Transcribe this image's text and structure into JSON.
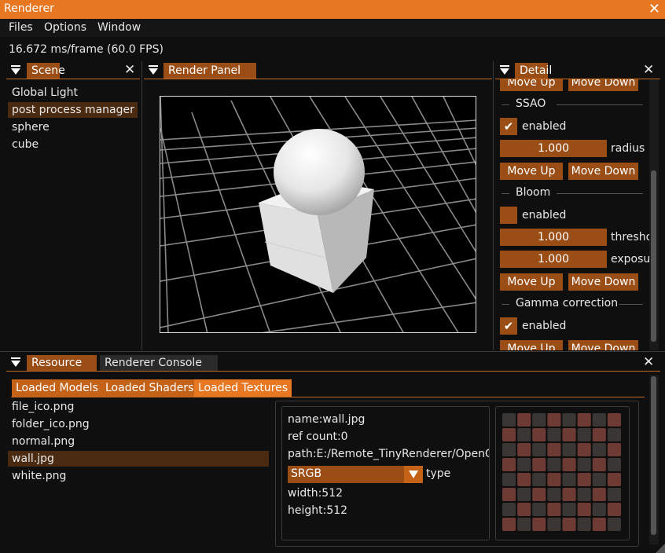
{
  "window": {
    "title": "Renderer"
  },
  "menu": [
    "Files",
    "Options",
    "Window"
  ],
  "status": {
    "fps_text": "16.672 ms/frame (60.0 FPS)"
  },
  "scene": {
    "tab": "Scene",
    "items": [
      "Global Light",
      "post process manager",
      "sphere",
      "cube"
    ],
    "selected_index": 1
  },
  "render_panel": {
    "tab": "Render Panel"
  },
  "detail": {
    "tab": "Detail",
    "move_up": "Move Up",
    "move_down": "Move Down",
    "enabled_label": "enabled",
    "sections": [
      {
        "title": "SSAO",
        "enabled": true,
        "fields": [
          {
            "value": "1.000",
            "label": "radius"
          }
        ]
      },
      {
        "title": "Bloom",
        "enabled": false,
        "fields": [
          {
            "value": "1.000",
            "label": "threshold"
          },
          {
            "value": "1.000",
            "label": "exposure"
          }
        ]
      },
      {
        "title": "Gamma correction",
        "enabled": true,
        "fields": []
      }
    ]
  },
  "bottom": {
    "tabs": [
      "Resource",
      "Renderer Console"
    ],
    "subtabs": [
      "Loaded Models",
      "Loaded Shaders",
      "Loaded Textures"
    ],
    "active_subtab": 2,
    "textures": [
      "file_ico.png",
      "folder_ico.png",
      "normal.png",
      "wall.jpg",
      "white.png"
    ],
    "selected_index": 3,
    "info": {
      "name": "name:wall.jpg",
      "ref_count": "ref count:0",
      "path": "path:E:/Remote_TinyRenderer/OpenGLRenderer",
      "format_value": "SRGB",
      "format_label": "type",
      "width": "width:512",
      "height": "height:512"
    }
  },
  "colors": {
    "accent": "#e87722",
    "widget": "#9a4e16",
    "background": "#0f0f0f"
  }
}
